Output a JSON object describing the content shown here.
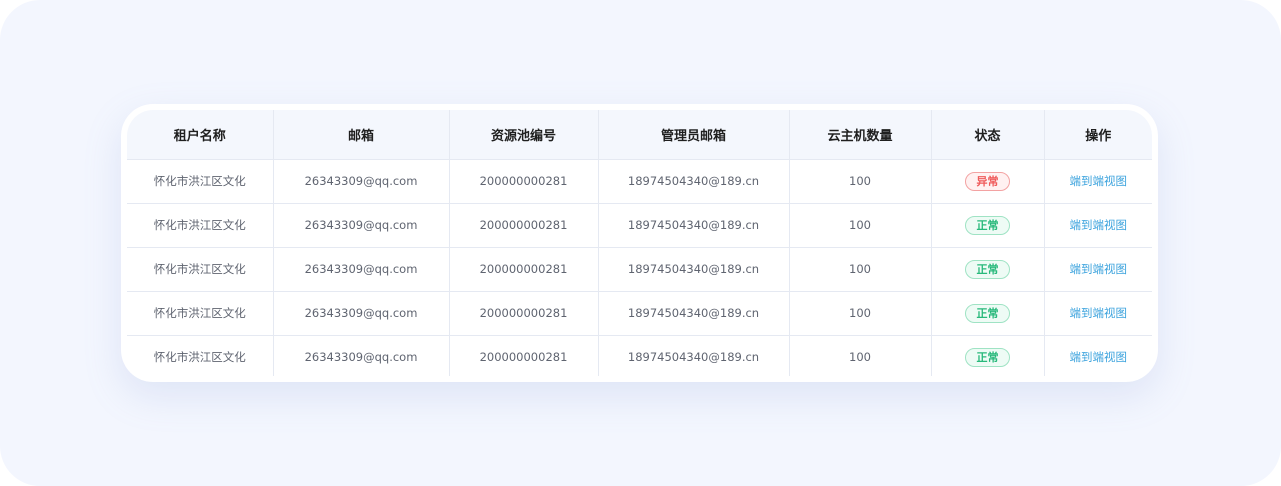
{
  "table": {
    "columns": [
      "租户名称",
      "邮箱",
      "资源池编号",
      "管理员邮箱",
      "云主机数量",
      "状态",
      "操作"
    ],
    "rows": [
      {
        "tenant": "怀化市洪江区文化",
        "email": "26343309@qq.com",
        "pool_id": "200000000281",
        "admin_email": "18974504340@189.cn",
        "vm_count": "100",
        "status": "异常",
        "action": "端到端视图"
      },
      {
        "tenant": "怀化市洪江区文化",
        "email": "26343309@qq.com",
        "pool_id": "200000000281",
        "admin_email": "18974504340@189.cn",
        "vm_count": "100",
        "status": "正常",
        "action": "端到端视图"
      },
      {
        "tenant": "怀化市洪江区文化",
        "email": "26343309@qq.com",
        "pool_id": "200000000281",
        "admin_email": "18974504340@189.cn",
        "vm_count": "100",
        "status": "正常",
        "action": "端到端视图"
      },
      {
        "tenant": "怀化市洪江区文化",
        "email": "26343309@qq.com",
        "pool_id": "200000000281",
        "admin_email": "18974504340@189.cn",
        "vm_count": "100",
        "status": "正常",
        "action": "端到端视图"
      },
      {
        "tenant": "怀化市洪江区文化",
        "email": "26343309@qq.com",
        "pool_id": "200000000281",
        "admin_email": "18974504340@189.cn",
        "vm_count": "100",
        "status": "正常",
        "action": "端到端视图"
      }
    ]
  },
  "colors": {
    "status_abnormal": "#ef5b5b",
    "status_normal": "#28b97b",
    "link": "#3aa2dd",
    "header_bg": "#f4f7fd",
    "page_bg": "#f3f6fe"
  }
}
